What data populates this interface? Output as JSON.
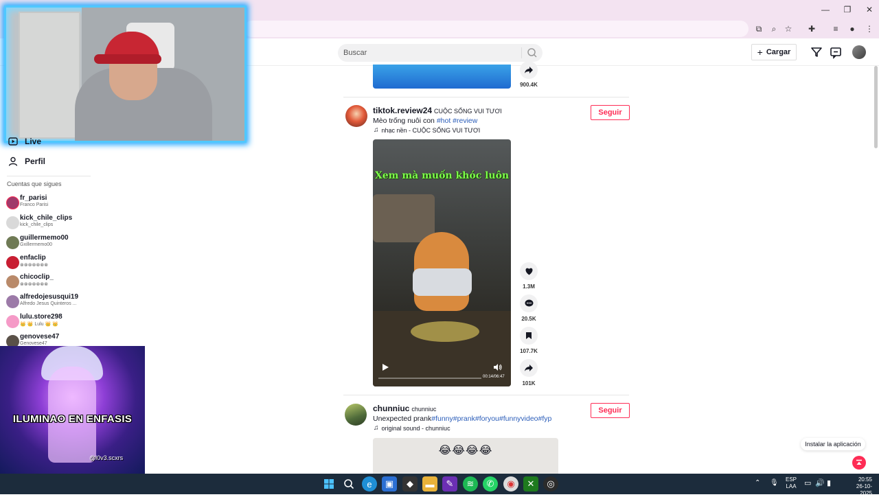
{
  "search": {
    "placeholder": "Buscar"
  },
  "header": {
    "upload_label": "Cargar"
  },
  "sidebar": {
    "nav": [
      {
        "label": "Live"
      },
      {
        "label": "Perfil"
      }
    ],
    "following_title": "Cuentas que sigues",
    "accounts": [
      {
        "username": "fr_parisi",
        "display": "Franco Parisi",
        "color": "#a03a6a"
      },
      {
        "username": "kick_chile_clips",
        "display": "kick_chile_clips",
        "color": "#d9d9d9"
      },
      {
        "username": "guillermemo00",
        "display": "Gxillermemo00",
        "color": "#6f7a55"
      },
      {
        "username": "enfaclip",
        "display": "⊗⊗⊗⊗⊗⊗⊗",
        "color": "#c81e32"
      },
      {
        "username": "chicoclip_",
        "display": "⊗⊗⊗⊗⊗⊗⊗",
        "color": "#b98a6a"
      },
      {
        "username": "alfredojesusqui19",
        "display": "Alfredo Jesus Quinteros ...",
        "color": "#9c7aa8"
      },
      {
        "username": "lulu.store298",
        "display": "👑 👑 Lulu 👑 👑",
        "color": "#f59ac7"
      },
      {
        "username": "genovese47",
        "display": "Genovese47",
        "color": "#5a5148"
      }
    ]
  },
  "overlay": {
    "title": "ILUMINAO EN ENFASIS",
    "handle": "@l0v3.scxrs"
  },
  "feed": {
    "prev_post": {
      "share_count": "900.4K"
    },
    "post1": {
      "username": "tiktok.review24",
      "nickname": "CUỘC SỐNG VUI TƯƠI",
      "caption_text": "Mèo trống nuôi con ",
      "caption_tags": "#hot #review",
      "music": "nhạc nền - CUỘC SỐNG VUI TƯƠI",
      "follow_label": "Seguir",
      "video_overlay_text": "Xem mà muốn khóc luôn",
      "video_time": "00:14/06:47",
      "likes": "1.3M",
      "comments": "20.5K",
      "saves": "107.7K",
      "shares": "101K"
    },
    "post2": {
      "username": "chunniuc",
      "nickname": "chunniuc",
      "caption_text": "Unexpected prank",
      "caption_tags": "#funny#prank#foryou#funnyvideo#fyp",
      "music": "original sound - chunniuc",
      "follow_label": "Seguir",
      "video_emoji": "😂😂😂😂"
    }
  },
  "install_app_label": "Instalar la aplicación",
  "taskbar": {
    "lang": "ESP",
    "lang_sub": "LAA",
    "time": "20:55",
    "date": "26-10-2025"
  }
}
